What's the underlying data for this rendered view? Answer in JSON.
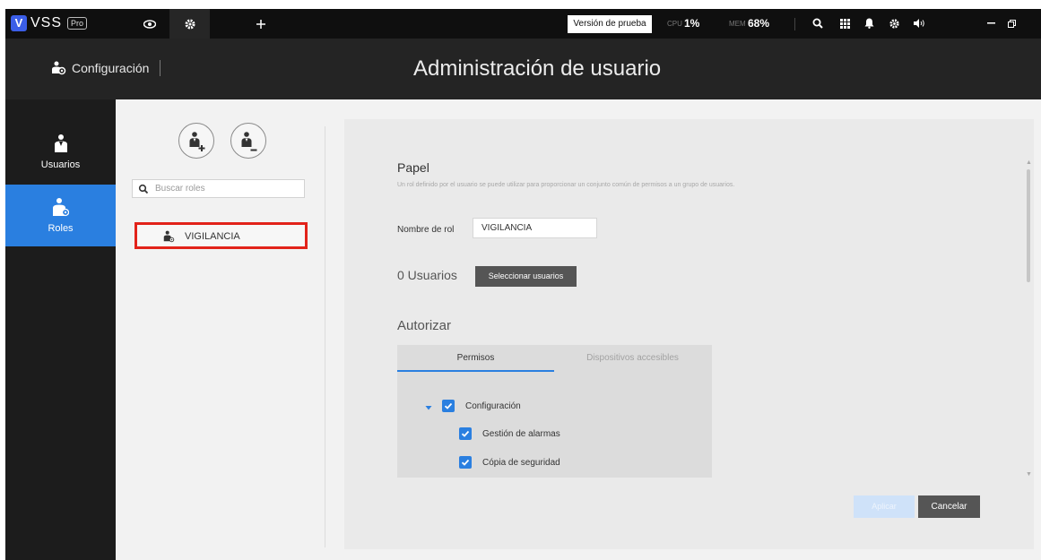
{
  "topbar": {
    "logo_letter": "V",
    "brand": "VSS",
    "edition": "Pro",
    "trial_label": "Versión de prueba",
    "cpu_label": "CPU",
    "cpu_value": "1%",
    "mem_label": "MEM",
    "mem_value": "68%",
    "tabs": [
      {
        "icon": "eye-icon",
        "active": false
      },
      {
        "icon": "gear-icon",
        "active": true
      },
      {
        "icon": "plus-icon",
        "active": false
      }
    ],
    "right_icons": [
      "search-icon",
      "grid-icon",
      "bell-icon",
      "gear-icon",
      "volume-icon",
      "minimize-icon",
      "restore-icon"
    ]
  },
  "header": {
    "section": "Configuración",
    "title": "Administración de usuario"
  },
  "leftnav": {
    "items": [
      {
        "label": "Usuarios",
        "icon": "user-icon",
        "active": false
      },
      {
        "label": "Roles",
        "icon": "user-role-icon",
        "active": true
      }
    ]
  },
  "roles_panel": {
    "search_placeholder": "Buscar roles",
    "roles": [
      {
        "label": "VIGILANCIA",
        "selected": true
      }
    ]
  },
  "main": {
    "section_title": "Papel",
    "section_desc": "Un rol definido por el usuario se puede utilizar para proporcionar un conjunto común de permisos a un grupo de usuarios.",
    "role_name_label": "Nombre de rol",
    "role_name_value": "VIGILANCIA",
    "users_count": "0 Usuarios",
    "select_users_label": "Seleccionar usuarios",
    "authorize_title": "Autorizar",
    "tabs": [
      {
        "label": "Permisos",
        "active": true
      },
      {
        "label": "Dispositivos accesibles",
        "active": false
      }
    ],
    "permissions": [
      {
        "label": "Configuración",
        "level": 0,
        "checked": true,
        "expanded": true
      },
      {
        "label": "Gestión de alarmas",
        "level": 1,
        "checked": true
      },
      {
        "label": "Cópia de seguridad",
        "level": 1,
        "checked": true
      }
    ],
    "apply_label": "Aplicar",
    "cancel_label": "Cancelar"
  },
  "colors": {
    "accent": "#2a7fe0",
    "highlight": "#e2231a",
    "topbar_bg": "#0f0f0f",
    "header_bg": "#242424",
    "nav_bg": "#1c1c1c"
  }
}
